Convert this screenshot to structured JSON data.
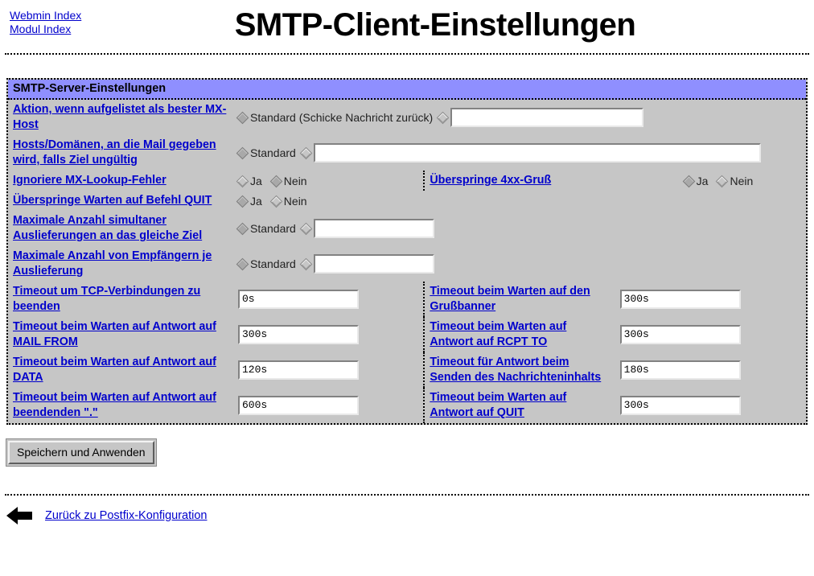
{
  "header": {
    "links": [
      {
        "label": "Webmin Index",
        "name": "webmin-index-link"
      },
      {
        "label": "Modul Index",
        "name": "modul-index-link"
      }
    ],
    "title": "SMTP-Client-Einstellungen"
  },
  "section": {
    "title": "SMTP-Server-Einstellungen"
  },
  "labels": {
    "best_mx": "Aktion, wenn aufgelistet als bester MX-Host",
    "hosts_domains": "Hosts/Domänen, an die Mail gegeben wird, falls Ziel ungültig ",
    "ignore_mx_lookup": "Ignoriere MX-Lookup-Fehler",
    "skip_4xx": "Überspringe 4xx-Gruß",
    "skip_quit_wait": "Überspringe Warten auf Befehl QUIT",
    "max_simultaneous": "Maximale Anzahl simultaner Auslieferungen an das gleiche Ziel",
    "max_recipients": "Maximale Anzahl von Empfängern je Auslieferung",
    "timeout_tcp_close": "Timeout um TCP-Verbindungen zu beenden",
    "timeout_greeting": "Timeout beim Warten auf den Grußbanner",
    "timeout_mail_from": "Timeout beim Warten auf Antwort auf MAIL FROM",
    "timeout_rcpt_to": "Timeout beim Warten auf Antwort auf RCPT TO",
    "timeout_data": "Timeout beim Warten auf Antwort auf DATA",
    "timeout_content": "Timeout für Antwort beim Senden des Nachrichteninhalts",
    "timeout_dot": "Timeout beim Warten auf Antwort auf beendenden \".\"",
    "timeout_quit": "Timeout beim Warten auf Antwort auf QUIT"
  },
  "options": {
    "default_bounce": "Standard (Schicke Nachricht zurück)",
    "default": "Standard",
    "yes": "Ja",
    "no": "Nein"
  },
  "fields": {
    "best_mx_value": "",
    "hosts_domains_value": "",
    "max_simultaneous_value": "",
    "max_recipients_value": "",
    "timeout_tcp_close_value": "0s",
    "timeout_greeting_value": "300s",
    "timeout_mail_from_value": "300s",
    "timeout_rcpt_to_value": "300s",
    "timeout_data_value": "120s",
    "timeout_content_value": "180s",
    "timeout_dot_value": "600s",
    "timeout_quit_value": "300s"
  },
  "selection": {
    "best_mx": "standard",
    "hosts_domains": "standard",
    "ignore_mx_lookup": "nein",
    "skip_4xx": "ja",
    "skip_quit_wait": "ja",
    "max_simultaneous": "standard",
    "max_recipients": "standard"
  },
  "actions": {
    "save_label": "Speichern und Anwenden",
    "back_label": "Zurück zu Postfix-Konfiguration"
  },
  "colors": {
    "link": "#0000cc",
    "section_bar": "#8f8fff",
    "table_bg": "#c6c6c6"
  }
}
